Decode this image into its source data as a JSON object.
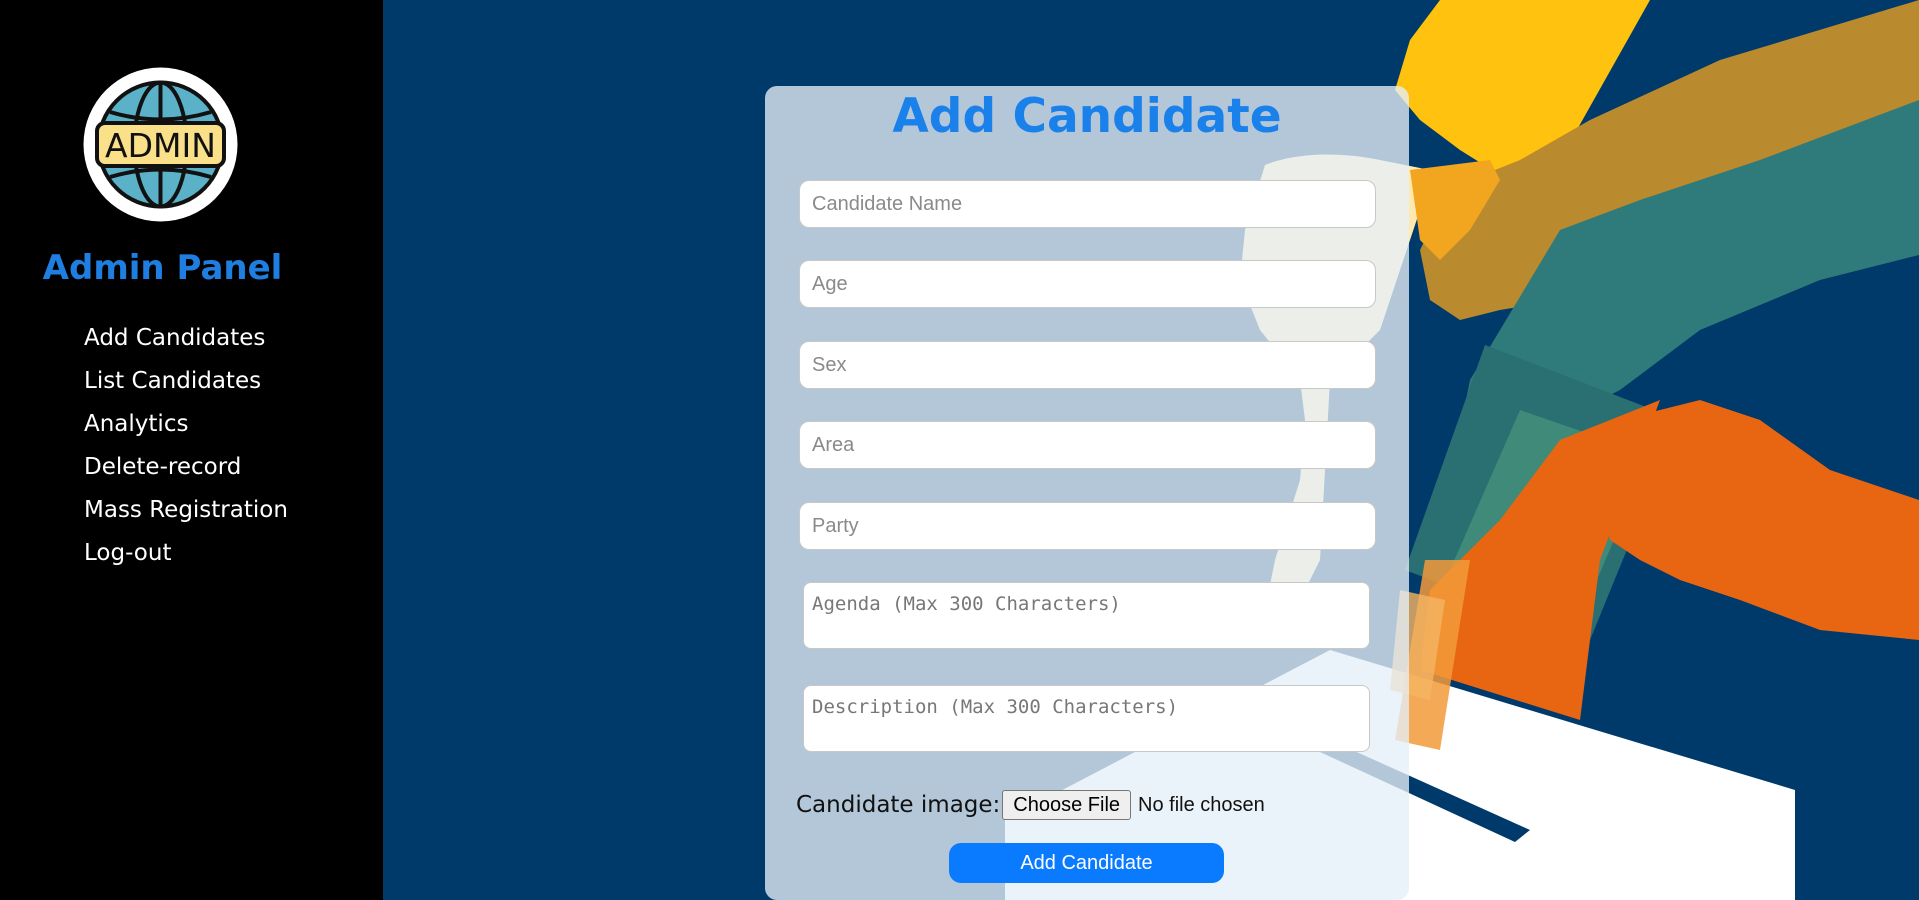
{
  "sidebar": {
    "logo_text": "ADMIN",
    "title": "Admin Panel",
    "items": [
      {
        "label": "Add Candidates"
      },
      {
        "label": "List Candidates"
      },
      {
        "label": "Analytics"
      },
      {
        "label": "Delete-record"
      },
      {
        "label": "Mass Registration"
      },
      {
        "label": "Log-out"
      }
    ]
  },
  "form": {
    "title": "Add Candidate",
    "fields": {
      "name": {
        "placeholder": "Candidate Name"
      },
      "age": {
        "placeholder": "Age"
      },
      "sex": {
        "placeholder": "Sex"
      },
      "area": {
        "placeholder": "Area"
      },
      "party": {
        "placeholder": "Party"
      },
      "agenda": {
        "placeholder": "Agenda (Max 300 Characters)"
      },
      "description": {
        "placeholder": "Description (Max 300 Characters)"
      }
    },
    "image_label": "Candidate image:",
    "file_button": "Choose File",
    "file_status": "No file chosen",
    "submit_label": "Add Candidate"
  },
  "colors": {
    "sidebar_bg": "#000000",
    "page_bg": "#003a6b",
    "accent": "#1a80ea",
    "button": "#0a7bff"
  }
}
